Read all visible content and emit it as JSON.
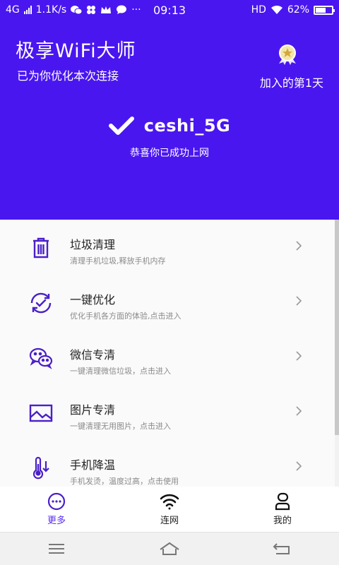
{
  "status_bar": {
    "network": "4G",
    "speed": "1.1K/s",
    "more": "···",
    "time": "09:13",
    "hd": "HD",
    "battery_text": "62%",
    "battery_level": 0.62
  },
  "header": {
    "app_title": "极享WiFi大师",
    "subtitle": "已为你优化本次连接",
    "joined_text": "加入的第1天"
  },
  "connection": {
    "ssid": "ceshi_5G",
    "status": "恭喜你已成功上网"
  },
  "colors": {
    "accent": "#4a16f0",
    "icon": "#4a1fc8"
  },
  "list_items": [
    {
      "icon": "trash-icon",
      "title": "垃圾清理",
      "desc": "清理手机垃圾,释放手机内存"
    },
    {
      "icon": "optimize-icon",
      "title": "一键优化",
      "desc": "优化手机各方面的体验,点击进入"
    },
    {
      "icon": "wechat-icon",
      "title": "微信专清",
      "desc": "一键清理微信垃圾，点击进入"
    },
    {
      "icon": "image-icon",
      "title": "图片专清",
      "desc": "一键清理无用图片，点击进入"
    },
    {
      "icon": "thermometer-icon",
      "title": "手机降温",
      "desc": "手机发烫，温度过高，点击使用"
    }
  ],
  "tabs": [
    {
      "icon": "more-icon",
      "label": "更多"
    },
    {
      "icon": "wifi-icon",
      "label": "连网"
    },
    {
      "icon": "user-icon",
      "label": "我的"
    }
  ]
}
